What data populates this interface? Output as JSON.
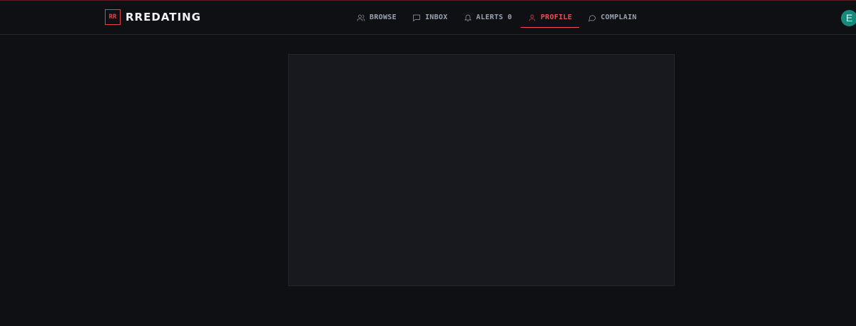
{
  "brand": {
    "mark": "RR",
    "name": "RREDATING"
  },
  "nav": {
    "items": [
      {
        "label": "BROWSE",
        "icon": "users-icon"
      },
      {
        "label": "INBOX",
        "icon": "message-square-icon"
      },
      {
        "label": "ALERTS",
        "icon": "bell-icon",
        "count": "0"
      },
      {
        "label": "PROFILE",
        "icon": "user-icon",
        "active": true
      },
      {
        "label": "COMPLAIN",
        "icon": "message-circle-icon"
      }
    ]
  },
  "user": {
    "avatar_initial": "E"
  },
  "colors": {
    "accent": "#ec4c53",
    "background": "#0f1014",
    "card": "#18191e",
    "avatar": "#15897a"
  }
}
